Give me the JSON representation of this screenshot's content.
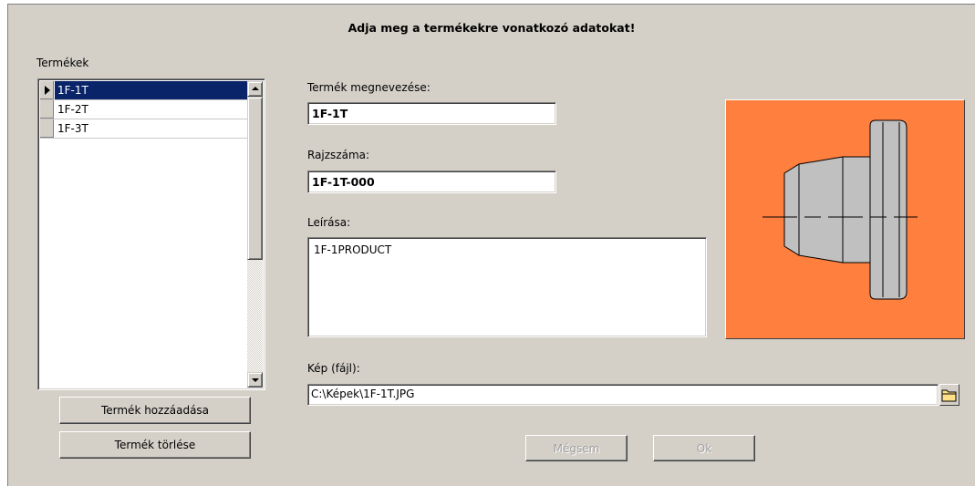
{
  "dialog": {
    "heading": "Adja meg a termékekre vonatkozó adatokat!"
  },
  "products": {
    "label": "Termékek",
    "items": [
      "1F-1T",
      "1F-2T",
      "1F-3T"
    ],
    "selected_index": 0,
    "add_button": "Termék hozzáadása",
    "delete_button": "Termék törlése"
  },
  "form": {
    "name_label": "Termék megnevezése:",
    "name_value": "1F-1T",
    "drawing_label": "Rajzszáma:",
    "drawing_value": "1F-1T-000",
    "description_label": "Leírása:",
    "description_value": "1F-1PRODUCT",
    "image_label": "Kép (fájl):",
    "image_value": "C:\\Képek\\1F-1T.JPG"
  },
  "actions": {
    "cancel_label": "Mégsem",
    "ok_label": "Ok"
  },
  "preview": {
    "background_color": "#ff7f3f",
    "part_color": "#c0c0c0"
  },
  "icons": {
    "browse": "folder-icon",
    "current_row": "row-pointer-icon",
    "scroll_up": "scroll-up-icon",
    "scroll_down": "scroll-down-icon"
  }
}
